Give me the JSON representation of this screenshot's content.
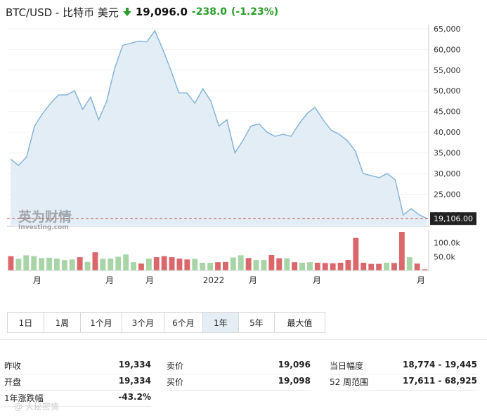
{
  "header": {
    "title": "BTC/USD - 比特币 美元",
    "price": "19,096.0",
    "change": "-238.0",
    "change_pct": "(-1.23%)",
    "arrow_color": "#2a9d2a",
    "change_color": "#2a9d2a"
  },
  "chart_data": {
    "type": "area",
    "y_ticks": [
      "65,000",
      "60,000",
      "55,000",
      "50,000",
      "45,000",
      "40,000",
      "35,000",
      "30,000",
      "25,000",
      "20,000"
    ],
    "ylim": [
      17611,
      66000
    ],
    "x_labels": [
      "月",
      "月",
      "月",
      "2022",
      "月",
      "月",
      "月"
    ],
    "last_price_label": "19,106.00",
    "last_price": 19106,
    "line_color": "#7fb1d8",
    "fill_color": "#e3edf6",
    "price_series": [
      33500,
      32000,
      34000,
      41500,
      44500,
      47000,
      49000,
      49000,
      50000,
      45500,
      48500,
      43000,
      47500,
      55500,
      61000,
      61500,
      62000,
      61800,
      64500,
      60000,
      55000,
      49500,
      49500,
      47000,
      50500,
      47500,
      41500,
      43000,
      35000,
      38000,
      41500,
      42000,
      40000,
      39000,
      39500,
      39000,
      42000,
      44500,
      46000,
      43000,
      40500,
      39500,
      38000,
      35500,
      30000,
      29500,
      29000,
      30000,
      28500,
      20000,
      21500,
      20000,
      19100
    ],
    "volume_ticks": [
      "100.0k",
      "50.0k"
    ],
    "volume_ylim": [
      0,
      140000
    ],
    "volume_series": [
      {
        "v": 52000,
        "up": false
      },
      {
        "v": 42000,
        "up": true
      },
      {
        "v": 55000,
        "up": true
      },
      {
        "v": 52000,
        "up": true
      },
      {
        "v": 45000,
        "up": true
      },
      {
        "v": 46000,
        "up": true
      },
      {
        "v": 43000,
        "up": true
      },
      {
        "v": 38000,
        "up": true
      },
      {
        "v": 40000,
        "up": true
      },
      {
        "v": 48000,
        "up": false
      },
      {
        "v": 31000,
        "up": true
      },
      {
        "v": 66000,
        "up": false
      },
      {
        "v": 42000,
        "up": true
      },
      {
        "v": 43000,
        "up": true
      },
      {
        "v": 50000,
        "up": true
      },
      {
        "v": 58000,
        "up": true
      },
      {
        "v": 30000,
        "up": true
      },
      {
        "v": 25000,
        "up": false
      },
      {
        "v": 43000,
        "up": true
      },
      {
        "v": 48000,
        "up": false
      },
      {
        "v": 52000,
        "up": false
      },
      {
        "v": 48000,
        "up": false
      },
      {
        "v": 43000,
        "up": false
      },
      {
        "v": 40000,
        "up": false
      },
      {
        "v": 42000,
        "up": true
      },
      {
        "v": 28000,
        "up": true
      },
      {
        "v": 28000,
        "up": true
      },
      {
        "v": 30000,
        "up": false
      },
      {
        "v": 31000,
        "up": false
      },
      {
        "v": 47000,
        "up": true
      },
      {
        "v": 55000,
        "up": true
      },
      {
        "v": 45000,
        "up": false
      },
      {
        "v": 38000,
        "up": true
      },
      {
        "v": 38000,
        "up": true
      },
      {
        "v": 56000,
        "up": false
      },
      {
        "v": 44000,
        "up": false
      },
      {
        "v": 44000,
        "up": true
      },
      {
        "v": 30000,
        "up": false
      },
      {
        "v": 28000,
        "up": true
      },
      {
        "v": 30000,
        "up": true
      },
      {
        "v": 28000,
        "up": false
      },
      {
        "v": 27000,
        "up": false
      },
      {
        "v": 26000,
        "up": false
      },
      {
        "v": 28000,
        "up": false
      },
      {
        "v": 38000,
        "up": false
      },
      {
        "v": 118000,
        "up": false
      },
      {
        "v": 28000,
        "up": false
      },
      {
        "v": 24000,
        "up": false
      },
      {
        "v": 24000,
        "up": false
      },
      {
        "v": 28000,
        "up": true
      },
      {
        "v": 27000,
        "up": false
      },
      {
        "v": 140000,
        "up": false
      },
      {
        "v": 48000,
        "up": true
      },
      {
        "v": 25000,
        "up": false
      },
      {
        "v": 4000,
        "up": false
      }
    ],
    "up_color": "#a8d5a8",
    "down_color": "#d9676b"
  },
  "watermark_logo": {
    "text": "英为财情",
    "sub": "Investing.com"
  },
  "ranges": [
    {
      "label": "1日",
      "active": false
    },
    {
      "label": "1周",
      "active": false
    },
    {
      "label": "1个月",
      "active": false
    },
    {
      "label": "3个月",
      "active": false
    },
    {
      "label": "6个月",
      "active": false
    },
    {
      "label": "1年",
      "active": true
    },
    {
      "label": "5年",
      "active": false
    },
    {
      "label": "最大值",
      "active": false
    }
  ],
  "stats": {
    "col1": [
      {
        "label": "昨收",
        "value": "19,334"
      },
      {
        "label": "开盘",
        "value": "19,334"
      },
      {
        "label": "1年涨跌幅",
        "value": "-43.2%"
      }
    ],
    "col2": [
      {
        "label": "卖价",
        "value": "19,096"
      },
      {
        "label": "买价",
        "value": "19,098"
      }
    ],
    "col3": [
      {
        "label": "当日幅度",
        "value": "18,774 - 19,445"
      },
      {
        "label": "52 周范围",
        "value": "17,611 - 68,925"
      }
    ]
  },
  "footer_watermark": "@ 大秘密情"
}
